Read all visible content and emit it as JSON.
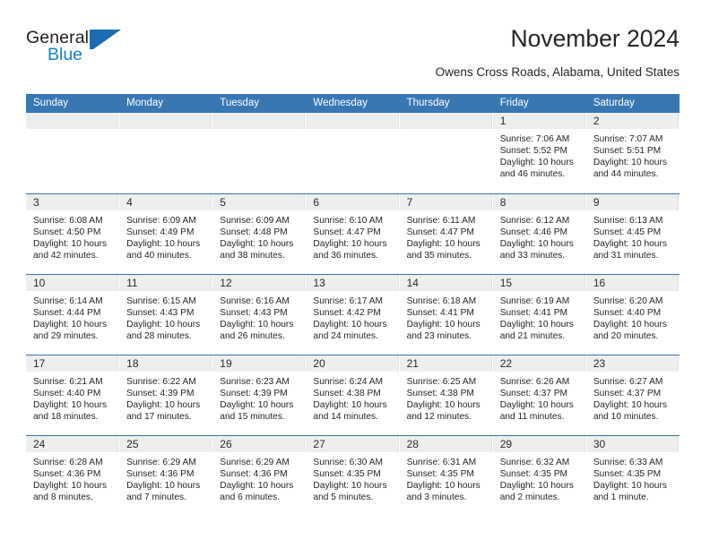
{
  "brand": {
    "name_part1": "General",
    "name_part2": "Blue",
    "logo_icon": "triangle-flag-icon",
    "accent_color": "#1b6cb3"
  },
  "header": {
    "title": "November 2024",
    "location": "Owens Cross Roads, Alabama, United States"
  },
  "calendar": {
    "header_color": "#3877b4",
    "day_band_color": "#eeeeee",
    "weekday_headers": [
      "Sunday",
      "Monday",
      "Tuesday",
      "Wednesday",
      "Thursday",
      "Friday",
      "Saturday"
    ],
    "weeks": [
      [
        {
          "day": "",
          "empty": true
        },
        {
          "day": "",
          "empty": true
        },
        {
          "day": "",
          "empty": true
        },
        {
          "day": "",
          "empty": true
        },
        {
          "day": "",
          "empty": true
        },
        {
          "day": "1",
          "sunrise": "Sunrise: 7:06 AM",
          "sunset": "Sunset: 5:52 PM",
          "daylight": "Daylight: 10 hours and 46 minutes."
        },
        {
          "day": "2",
          "sunrise": "Sunrise: 7:07 AM",
          "sunset": "Sunset: 5:51 PM",
          "daylight": "Daylight: 10 hours and 44 minutes."
        }
      ],
      [
        {
          "day": "3",
          "sunrise": "Sunrise: 6:08 AM",
          "sunset": "Sunset: 4:50 PM",
          "daylight": "Daylight: 10 hours and 42 minutes."
        },
        {
          "day": "4",
          "sunrise": "Sunrise: 6:09 AM",
          "sunset": "Sunset: 4:49 PM",
          "daylight": "Daylight: 10 hours and 40 minutes."
        },
        {
          "day": "5",
          "sunrise": "Sunrise: 6:09 AM",
          "sunset": "Sunset: 4:48 PM",
          "daylight": "Daylight: 10 hours and 38 minutes."
        },
        {
          "day": "6",
          "sunrise": "Sunrise: 6:10 AM",
          "sunset": "Sunset: 4:47 PM",
          "daylight": "Daylight: 10 hours and 36 minutes."
        },
        {
          "day": "7",
          "sunrise": "Sunrise: 6:11 AM",
          "sunset": "Sunset: 4:47 PM",
          "daylight": "Daylight: 10 hours and 35 minutes."
        },
        {
          "day": "8",
          "sunrise": "Sunrise: 6:12 AM",
          "sunset": "Sunset: 4:46 PM",
          "daylight": "Daylight: 10 hours and 33 minutes."
        },
        {
          "day": "9",
          "sunrise": "Sunrise: 6:13 AM",
          "sunset": "Sunset: 4:45 PM",
          "daylight": "Daylight: 10 hours and 31 minutes."
        }
      ],
      [
        {
          "day": "10",
          "sunrise": "Sunrise: 6:14 AM",
          "sunset": "Sunset: 4:44 PM",
          "daylight": "Daylight: 10 hours and 29 minutes."
        },
        {
          "day": "11",
          "sunrise": "Sunrise: 6:15 AM",
          "sunset": "Sunset: 4:43 PM",
          "daylight": "Daylight: 10 hours and 28 minutes."
        },
        {
          "day": "12",
          "sunrise": "Sunrise: 6:16 AM",
          "sunset": "Sunset: 4:43 PM",
          "daylight": "Daylight: 10 hours and 26 minutes."
        },
        {
          "day": "13",
          "sunrise": "Sunrise: 6:17 AM",
          "sunset": "Sunset: 4:42 PM",
          "daylight": "Daylight: 10 hours and 24 minutes."
        },
        {
          "day": "14",
          "sunrise": "Sunrise: 6:18 AM",
          "sunset": "Sunset: 4:41 PM",
          "daylight": "Daylight: 10 hours and 23 minutes."
        },
        {
          "day": "15",
          "sunrise": "Sunrise: 6:19 AM",
          "sunset": "Sunset: 4:41 PM",
          "daylight": "Daylight: 10 hours and 21 minutes."
        },
        {
          "day": "16",
          "sunrise": "Sunrise: 6:20 AM",
          "sunset": "Sunset: 4:40 PM",
          "daylight": "Daylight: 10 hours and 20 minutes."
        }
      ],
      [
        {
          "day": "17",
          "sunrise": "Sunrise: 6:21 AM",
          "sunset": "Sunset: 4:40 PM",
          "daylight": "Daylight: 10 hours and 18 minutes."
        },
        {
          "day": "18",
          "sunrise": "Sunrise: 6:22 AM",
          "sunset": "Sunset: 4:39 PM",
          "daylight": "Daylight: 10 hours and 17 minutes."
        },
        {
          "day": "19",
          "sunrise": "Sunrise: 6:23 AM",
          "sunset": "Sunset: 4:39 PM",
          "daylight": "Daylight: 10 hours and 15 minutes."
        },
        {
          "day": "20",
          "sunrise": "Sunrise: 6:24 AM",
          "sunset": "Sunset: 4:38 PM",
          "daylight": "Daylight: 10 hours and 14 minutes."
        },
        {
          "day": "21",
          "sunrise": "Sunrise: 6:25 AM",
          "sunset": "Sunset: 4:38 PM",
          "daylight": "Daylight: 10 hours and 12 minutes."
        },
        {
          "day": "22",
          "sunrise": "Sunrise: 6:26 AM",
          "sunset": "Sunset: 4:37 PM",
          "daylight": "Daylight: 10 hours and 11 minutes."
        },
        {
          "day": "23",
          "sunrise": "Sunrise: 6:27 AM",
          "sunset": "Sunset: 4:37 PM",
          "daylight": "Daylight: 10 hours and 10 minutes."
        }
      ],
      [
        {
          "day": "24",
          "sunrise": "Sunrise: 6:28 AM",
          "sunset": "Sunset: 4:36 PM",
          "daylight": "Daylight: 10 hours and 8 minutes."
        },
        {
          "day": "25",
          "sunrise": "Sunrise: 6:29 AM",
          "sunset": "Sunset: 4:36 PM",
          "daylight": "Daylight: 10 hours and 7 minutes."
        },
        {
          "day": "26",
          "sunrise": "Sunrise: 6:29 AM",
          "sunset": "Sunset: 4:36 PM",
          "daylight": "Daylight: 10 hours and 6 minutes."
        },
        {
          "day": "27",
          "sunrise": "Sunrise: 6:30 AM",
          "sunset": "Sunset: 4:35 PM",
          "daylight": "Daylight: 10 hours and 5 minutes."
        },
        {
          "day": "28",
          "sunrise": "Sunrise: 6:31 AM",
          "sunset": "Sunset: 4:35 PM",
          "daylight": "Daylight: 10 hours and 3 minutes."
        },
        {
          "day": "29",
          "sunrise": "Sunrise: 6:32 AM",
          "sunset": "Sunset: 4:35 PM",
          "daylight": "Daylight: 10 hours and 2 minutes."
        },
        {
          "day": "30",
          "sunrise": "Sunrise: 6:33 AM",
          "sunset": "Sunset: 4:35 PM",
          "daylight": "Daylight: 10 hours and 1 minute."
        }
      ]
    ]
  }
}
